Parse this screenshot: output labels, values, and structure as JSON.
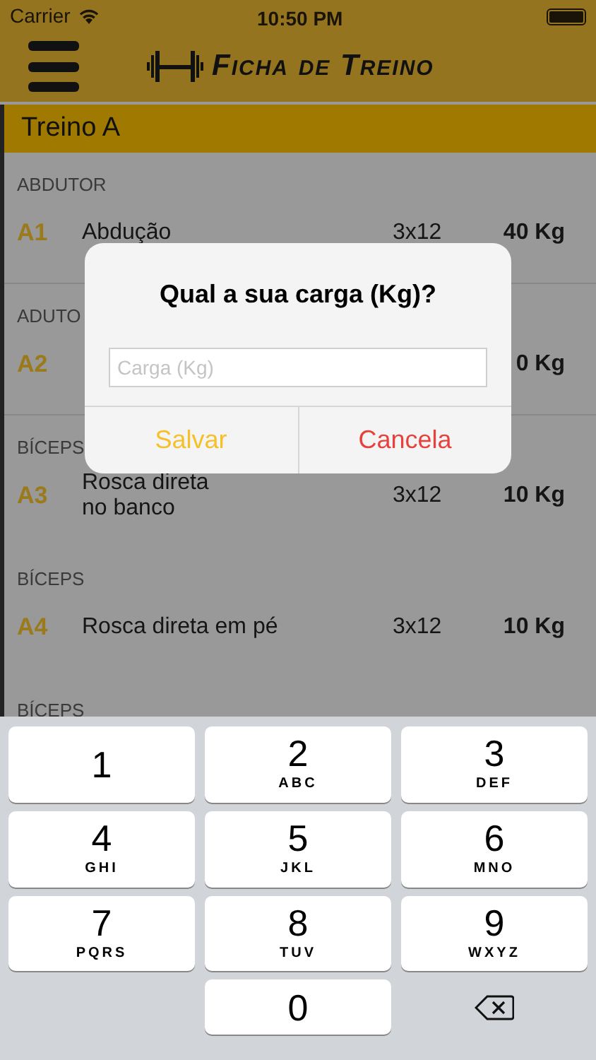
{
  "status_bar": {
    "carrier": "Carrier",
    "time": "10:50 PM"
  },
  "header": {
    "title": "Ficha de Treino"
  },
  "section": {
    "title": "Treino A"
  },
  "exercises": [
    {
      "group": "ABDUTOR",
      "code": "A1",
      "name": "Abdução",
      "sets": "3x12",
      "weight": "40 Kg"
    },
    {
      "group": "ADUTO",
      "code": "A2",
      "weight": "0 Kg"
    },
    {
      "group": "BÍCEPS",
      "code": "A3",
      "name": "Rosca direta\nno banco",
      "sets": "3x12",
      "weight": "10 Kg"
    },
    {
      "group": "BÍCEPS",
      "code": "A4",
      "name": "Rosca direta em pé",
      "sets": "3x12",
      "weight": "10 Kg"
    },
    {
      "group": "BÍCEPS"
    }
  ],
  "dialog": {
    "title": "Qual a sua carga (Kg)?",
    "field": {
      "placeholder": "Carga (Kg)"
    },
    "buttons": [
      {
        "label": "Salvar",
        "kind": "confirm"
      },
      {
        "label": "Cancela",
        "kind": "cancel"
      }
    ]
  },
  "keyboard": {
    "keys": [
      {
        "kind": "digit",
        "digit": "1"
      },
      {
        "kind": "digit",
        "digit": "2",
        "letters": "ABC"
      },
      {
        "kind": "digit",
        "digit": "3",
        "letters": "DEF"
      },
      {
        "kind": "digit",
        "digit": "4",
        "letters": "GHI"
      },
      {
        "kind": "digit",
        "digit": "5",
        "letters": "JKL"
      },
      {
        "kind": "digit",
        "digit": "6",
        "letters": "MNO"
      },
      {
        "kind": "digit",
        "digit": "7",
        "letters": "PQRS"
      },
      {
        "kind": "digit",
        "digit": "8",
        "letters": "TUV"
      },
      {
        "kind": "digit",
        "digit": "9",
        "letters": "WXYZ"
      },
      {
        "kind": "blank"
      },
      {
        "kind": "digit",
        "digit": "0"
      },
      {
        "kind": "delete"
      }
    ]
  }
}
